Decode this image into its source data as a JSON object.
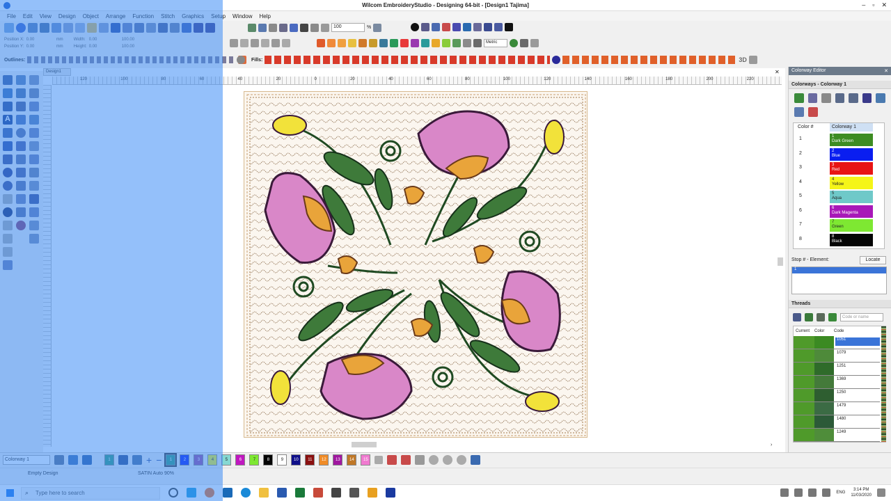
{
  "window": {
    "title": "Wilcom EmbroideryStudio - Designing 64-bit - [Design1     Tajima]",
    "minimize": "–",
    "maximize": "▫",
    "close": "✕"
  },
  "menu": [
    "File",
    "Edit",
    "View",
    "Design",
    "Object",
    "Arrange",
    "Function",
    "Stitch",
    "Graphics",
    "Setup",
    "Window",
    "Help"
  ],
  "toolbar": {
    "zoom_value": "100",
    "zoom_unit": "%",
    "units": "Metric",
    "outlines_label": "Outlines:",
    "fills_label": "Fills:",
    "fill_3d": "3D",
    "pos_x_label": "Position X:",
    "pos_y_label": "Position Y:",
    "width_label": "Width:",
    "height_label": "Height:",
    "pos_x": "0.00",
    "pos_y": "0.00",
    "width": "0.00",
    "height": "0.00",
    "w_pct": "100.00",
    "h_pct": "100.00",
    "mm1": "mm",
    "mm2": "mm"
  },
  "document_tab": "Design1",
  "ruler_top": [
    "120",
    "100",
    "80",
    "60",
    "40",
    "20",
    "0",
    "20",
    "40",
    "60",
    "80",
    "100",
    "120",
    "140",
    "160",
    "180",
    "200",
    "220"
  ],
  "right_panel": {
    "title": "Colorway Editor",
    "colorways_header": "Colorways - Colorway 1",
    "color_col": "Color #",
    "colorway_col": "Colorway 1",
    "colors": [
      {
        "num": "1",
        "idx": "1",
        "name": "Dark Green",
        "hex": "#3d8c22"
      },
      {
        "num": "2",
        "idx": "2",
        "name": "Blue",
        "hex": "#0a1ef0"
      },
      {
        "num": "3",
        "idx": "3",
        "name": "Red",
        "hex": "#e81414"
      },
      {
        "num": "4",
        "idx": "4",
        "name": "Yellow",
        "hex": "#f5f518"
      },
      {
        "num": "5",
        "idx": "5",
        "name": "Aqua",
        "hex": "#6fc9c9"
      },
      {
        "num": "6",
        "idx": "6",
        "name": "Dark Magenta",
        "hex": "#a818b8"
      },
      {
        "num": "7",
        "idx": "7",
        "name": "Green",
        "hex": "#7ee832"
      },
      {
        "num": "8",
        "idx": "8",
        "name": "Black",
        "hex": "#050505"
      }
    ],
    "stop_label": "Stop # - Element:",
    "locate_button": "Locate",
    "stop_value": "1",
    "threads_header": "Threads",
    "threads_search_placeholder": "Code or name",
    "threads_cols": [
      "Current",
      "Color",
      "Code"
    ],
    "threads": [
      {
        "code": "1051",
        "hex": "#3b8a22"
      },
      {
        "code": "1079",
        "hex": "#4e8a3a"
      },
      {
        "code": "1251",
        "hex": "#2f6b2a"
      },
      {
        "code": "1369",
        "hex": "#447a3a"
      },
      {
        "code": "1250",
        "hex": "#2e5e30"
      },
      {
        "code": "1479",
        "hex": "#3b6b44"
      },
      {
        "code": "1480",
        "hex": "#2c5a38"
      },
      {
        "code": "1249",
        "hex": "#4f8d3a"
      }
    ]
  },
  "bottom": {
    "colorway_select": "Colorway 1",
    "swatches": [
      {
        "n": "1",
        "hex": "#2d9a7a"
      },
      {
        "n": "2",
        "hex": "#0a1ef0"
      },
      {
        "n": "3",
        "hex": "#9a4aa0"
      },
      {
        "n": "4",
        "hex": "#f5f518"
      },
      {
        "n": "5",
        "hex": "#86d8d2"
      },
      {
        "n": "6",
        "hex": "#c018c0"
      },
      {
        "n": "7",
        "hex": "#7ee832"
      },
      {
        "n": "8",
        "hex": "#050505"
      },
      {
        "n": "9",
        "hex": "#ffffff"
      },
      {
        "n": "10",
        "hex": "#10108a"
      },
      {
        "n": "11",
        "hex": "#8a1010"
      },
      {
        "n": "12",
        "hex": "#f08c28"
      },
      {
        "n": "13",
        "hex": "#a018a0"
      },
      {
        "n": "14",
        "hex": "#c07828"
      },
      {
        "n": "15",
        "hex": "#f07ad0"
      }
    ]
  },
  "status": {
    "left": "Empty Design",
    "middle": "SATIN Auto 90%"
  },
  "taskbar": {
    "search_placeholder": "Type here to search",
    "lang": "ENG",
    "time": "3:14 PM",
    "date": "11/03/2020"
  }
}
